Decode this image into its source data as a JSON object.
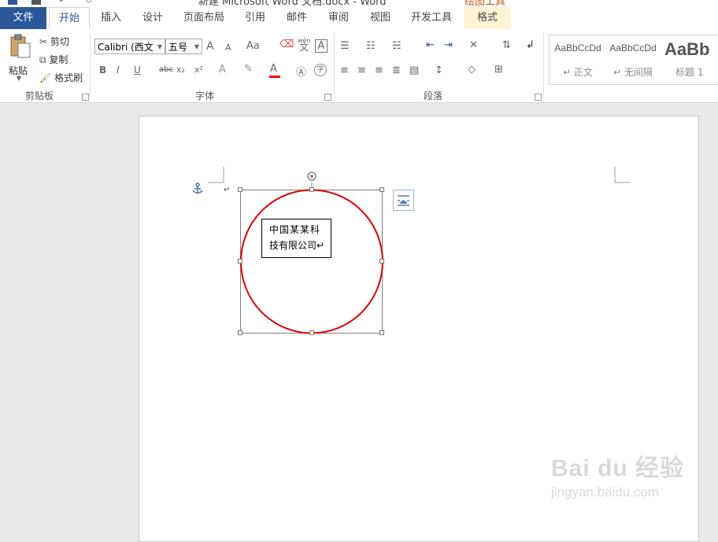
{
  "window": {
    "title": "新建 Microsoft Word 文档.docx - Word",
    "context_tool": "绘图工具"
  },
  "tabs": {
    "file": "文件",
    "home": "开始",
    "insert": "插入",
    "design": "设计",
    "layout": "页面布局",
    "references": "引用",
    "mailings": "邮件",
    "review": "审阅",
    "view": "视图",
    "developer": "开发工具",
    "format": "格式"
  },
  "clipboard": {
    "paste": "粘贴",
    "cut": "剪切",
    "copy": "复制",
    "format_painter": "格式刷",
    "group": "剪贴板"
  },
  "font": {
    "name": "Calibri (西文",
    "size": "五号",
    "group": "字体",
    "bold": "B",
    "italic": "I",
    "underline": "U",
    "strike": "abc",
    "subscript": "x₂",
    "superscript": "x²",
    "grow": "A",
    "shrink": "A",
    "case": "Aa",
    "phonetic_top": "wén",
    "phonetic_bottom": "文",
    "border_char": "A",
    "font_color": "A",
    "enclose": "字",
    "effects": "A"
  },
  "paragraph": {
    "group": "段落"
  },
  "styles": {
    "items": [
      {
        "sample": "AaBbCcDd",
        "name": "↵ 正文"
      },
      {
        "sample": "AaBbCcDd",
        "name": "↵ 无间隔"
      },
      {
        "sample": "AaBb",
        "name": "标题 1"
      }
    ]
  },
  "document": {
    "textbox_line1": "中国某某科",
    "textbox_line2": "技有限公司↵",
    "paragraph_mark": "↵"
  },
  "watermark": {
    "brand": "Bai du 经验",
    "url": "jingyan.baidu.com"
  },
  "colors": {
    "accent": "#2b579a",
    "circle_stroke": "#e00000",
    "font_color_bar": "#ff0000",
    "context_tab_bg": "#fff3d6"
  }
}
